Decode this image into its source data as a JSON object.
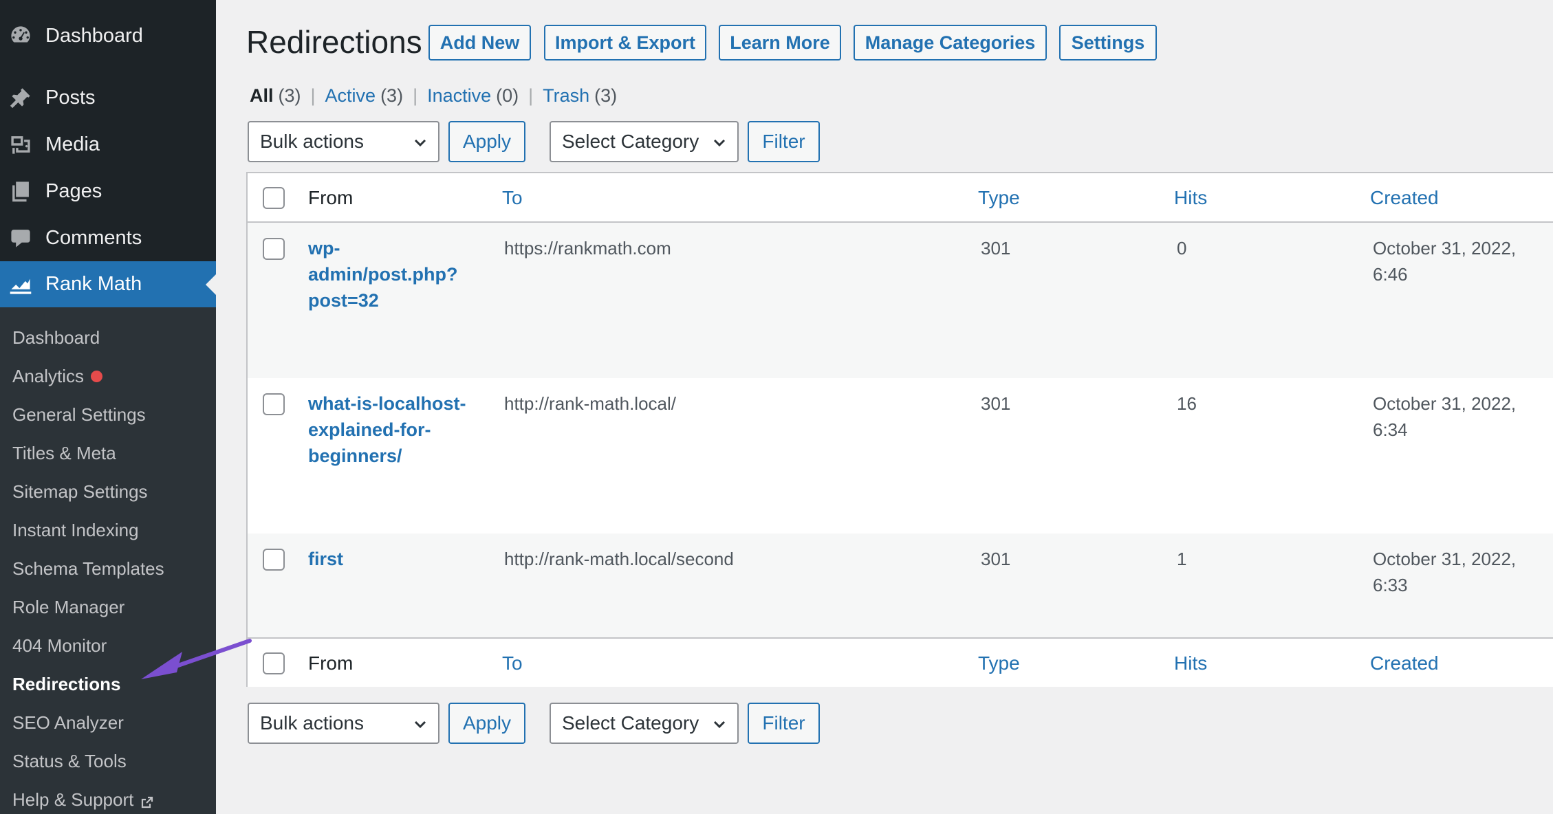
{
  "sidebar": {
    "top_items": [
      {
        "label": "Dashboard",
        "icon": "dashboard-icon"
      },
      {
        "label": "Posts",
        "icon": "pushpin-icon"
      },
      {
        "label": "Media",
        "icon": "media-icon"
      },
      {
        "label": "Pages",
        "icon": "pages-icon"
      },
      {
        "label": "Comments",
        "icon": "comment-icon"
      },
      {
        "label": "Rank Math",
        "icon": "rank-math-icon"
      }
    ],
    "submenu": [
      {
        "label": "Dashboard"
      },
      {
        "label": "Analytics"
      },
      {
        "label": "General Settings"
      },
      {
        "label": "Titles & Meta"
      },
      {
        "label": "Sitemap Settings"
      },
      {
        "label": "Instant Indexing"
      },
      {
        "label": "Schema Templates"
      },
      {
        "label": "Role Manager"
      },
      {
        "label": "404 Monitor"
      },
      {
        "label": "Redirections"
      },
      {
        "label": "SEO Analyzer"
      },
      {
        "label": "Status & Tools"
      },
      {
        "label": "Help & Support"
      }
    ],
    "active_submenu": "Redirections",
    "accent_color": "#2271b1",
    "notification_dot_color": "#e64b4b"
  },
  "header": {
    "title": "Redirections",
    "buttons": {
      "add_new": "Add New",
      "import_export": "Import & Export",
      "learn_more": "Learn More",
      "manage_categories": "Manage Categories",
      "settings": "Settings"
    }
  },
  "views": {
    "all": {
      "label": "All",
      "count": "(3)"
    },
    "active": {
      "label": "Active",
      "count": "(3)"
    },
    "inactive": {
      "label": "Inactive",
      "count": "(0)"
    },
    "trash": {
      "label": "Trash",
      "count": "(3)"
    },
    "separator": "|"
  },
  "tablenav": {
    "bulk_actions": "Bulk actions",
    "apply": "Apply",
    "select_category": "Select Category",
    "filter": "Filter"
  },
  "table": {
    "columns": {
      "from": "From",
      "to": "To",
      "type": "Type",
      "hits": "Hits",
      "created": "Created"
    },
    "rows": [
      {
        "from": "wp-admin/post.php?post=32",
        "to": "https://rankmath.com",
        "type": "301",
        "hits": "0",
        "created": "October 31, 2022, 6:46"
      },
      {
        "from": "what-is-localhost-explained-for-beginners/",
        "to": "http://rank-math.local/",
        "type": "301",
        "hits": "16",
        "created": "October 31, 2022, 6:34"
      },
      {
        "from": "first",
        "to": "http://rank-math.local/second",
        "type": "301",
        "hits": "1",
        "created": "October 31, 2022, 6:33"
      }
    ]
  },
  "annotation": {
    "arrow_color": "#7b4fd0"
  }
}
